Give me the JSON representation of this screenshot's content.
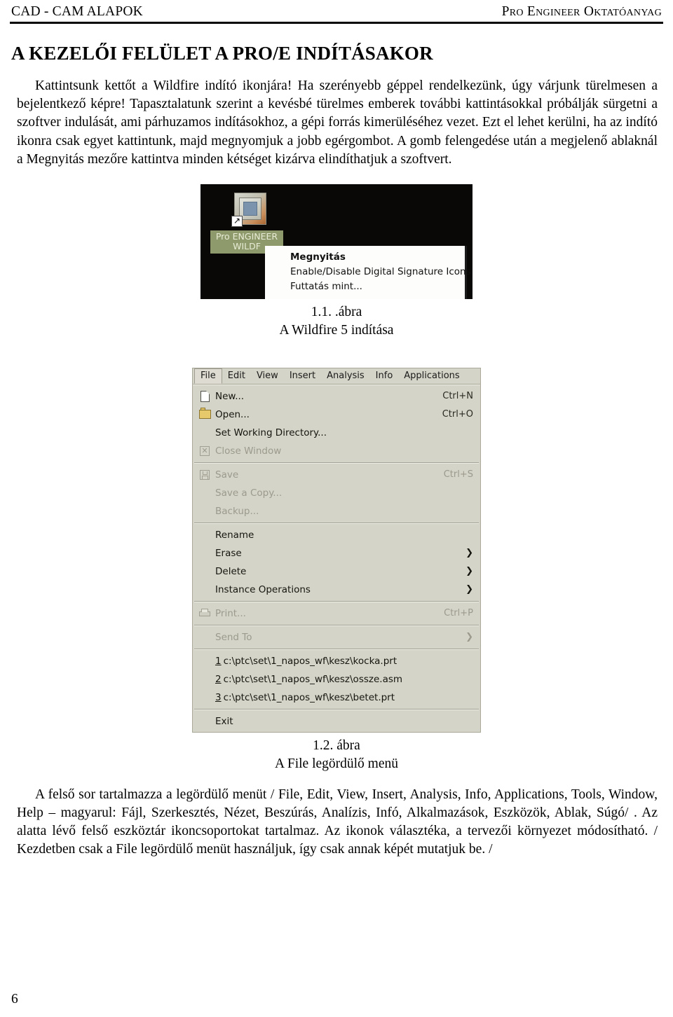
{
  "header": {
    "left": "CAD - CAM ALAPOK",
    "right": "Pro Engineer Oktatóanyag"
  },
  "section_title": "A KEZELŐI FELÜLET A PRO/E INDÍTÁSAKOR",
  "intro_paragraph": "Kattintsunk kettőt a Wildfire indító ikonjára! Ha szerényebb géppel rendelkezünk, úgy várjunk türelmesen a bejelentkező képre! Tapasztalatunk szerint a kevésbé türelmes emberek további kattintásokkal próbálják sürgetni a szoftver indulását, ami párhuzamos indításokhoz, a gépi forrás kimerüléséhez vezet. Ezt el lehet kerülni, ha az indító ikonra csak egyet kattintunk, majd megnyomjuk a jobb egérgombot. A gomb felengedése után a megjelenő ablaknál a Megnyitás mezőre kattintva minden kétséget kizárva elindíthatjuk a szoftvert.",
  "figure1": {
    "desktop_icon": {
      "label_line1": "Pro ENGINEER",
      "label_line2": "WILDF",
      "shortcut_arrow": "↗"
    },
    "context_menu": [
      {
        "label": "Megnyitás",
        "bold": true,
        "mnemonic": "e"
      },
      {
        "label": "Enable/Disable Digital Signature Icons",
        "bold": false,
        "mnemonic": "E"
      },
      {
        "label": "Futtatás mint...",
        "bold": false,
        "mnemonic": "i"
      }
    ],
    "caption_line1": "1.1. .ábra",
    "caption_line2": "A Wildfire 5 indítása"
  },
  "figure2": {
    "menubar": [
      {
        "label": "File",
        "active": true
      },
      {
        "label": "Edit",
        "active": false
      },
      {
        "label": "View",
        "active": false
      },
      {
        "label": "Insert",
        "active": false
      },
      {
        "label": "Analysis",
        "active": false
      },
      {
        "label": "Info",
        "active": false
      },
      {
        "label": "Applications",
        "active": false
      }
    ],
    "menu_items": [
      {
        "type": "item",
        "icon": "new-document-icon",
        "label": "New...",
        "accel": "Ctrl+N",
        "disabled": false,
        "submenu": false
      },
      {
        "type": "item",
        "icon": "open-folder-icon",
        "label": "Open...",
        "accel": "Ctrl+O",
        "disabled": false,
        "submenu": false
      },
      {
        "type": "item",
        "icon": "",
        "label": "Set Working Directory...",
        "accel": "",
        "disabled": false,
        "submenu": false
      },
      {
        "type": "item",
        "icon": "close-window-icon",
        "label": "Close Window",
        "accel": "",
        "disabled": true,
        "submenu": false
      },
      {
        "type": "separator"
      },
      {
        "type": "item",
        "icon": "save-disk-icon",
        "label": "Save",
        "accel": "Ctrl+S",
        "disabled": true,
        "submenu": false
      },
      {
        "type": "item",
        "icon": "",
        "label": "Save a Copy...",
        "accel": "",
        "disabled": true,
        "submenu": false
      },
      {
        "type": "item",
        "icon": "",
        "label": "Backup...",
        "accel": "",
        "disabled": true,
        "submenu": false
      },
      {
        "type": "separator"
      },
      {
        "type": "item",
        "icon": "",
        "label": "Rename",
        "accel": "",
        "disabled": false,
        "submenu": false
      },
      {
        "type": "item",
        "icon": "",
        "label": "Erase",
        "accel": "",
        "disabled": false,
        "submenu": true
      },
      {
        "type": "item",
        "icon": "",
        "label": "Delete",
        "accel": "",
        "disabled": false,
        "submenu": true
      },
      {
        "type": "item",
        "icon": "",
        "label": "Instance Operations",
        "accel": "",
        "disabled": false,
        "submenu": true
      },
      {
        "type": "separator"
      },
      {
        "type": "item",
        "icon": "printer-icon",
        "label": "Print...",
        "accel": "Ctrl+P",
        "disabled": true,
        "submenu": false
      },
      {
        "type": "separator"
      },
      {
        "type": "item",
        "icon": "",
        "label": "Send To",
        "accel": "",
        "disabled": true,
        "submenu": true
      },
      {
        "type": "separator"
      },
      {
        "type": "recent",
        "num": "1",
        "label": "c:\\ptc\\set\\1_napos_wf\\kesz\\kocka.prt"
      },
      {
        "type": "recent",
        "num": "2",
        "label": "c:\\ptc\\set\\1_napos_wf\\kesz\\ossze.asm"
      },
      {
        "type": "recent",
        "num": "3",
        "label": "c:\\ptc\\set\\1_napos_wf\\kesz\\betet.prt"
      },
      {
        "type": "separator"
      },
      {
        "type": "item",
        "icon": "",
        "label": "Exit",
        "accel": "",
        "disabled": false,
        "submenu": false
      }
    ],
    "caption_line1": "1.2. ábra",
    "caption_line2": "A File legördülő menü"
  },
  "closing_paragraph": "A felső sor tartalmazza a legördülő menüt / File, Edit, View, Insert, Analysis, Info, Applications, Tools, Window, Help – magyarul: Fájl, Szerkesztés, Nézet, Beszúrás, Analízis, Infó, Alkalmazások, Eszközök, Ablak, Súgó/ . Az alatta lévő felső eszköztár ikoncsoportokat tartalmaz. Az ikonok választéka, a tervezői környezet módosítható. / Kezdetben csak a File legördülő menüt használjuk, így csak annak képét mutatjuk be. /",
  "page_number": "6",
  "colors": {
    "menu_background": "#d5d4c8",
    "menu_disabled_text": "#9b9a8d",
    "desktop_background": "#0a0806",
    "desktop_label_highlight": "#8e9a6c",
    "context_menu_background": "#fdfdfb"
  }
}
